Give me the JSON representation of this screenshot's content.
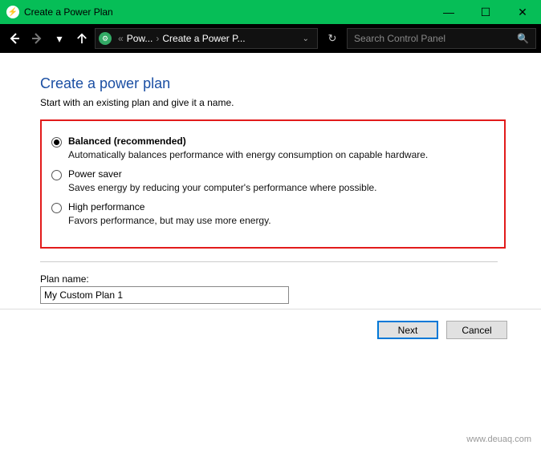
{
  "window": {
    "title": "Create a Power Plan"
  },
  "breadcrumb": {
    "root_prefix": "«",
    "root": "Pow...",
    "current": "Create a Power P..."
  },
  "search": {
    "placeholder": "Search Control Panel"
  },
  "page": {
    "heading": "Create a power plan",
    "subheading": "Start with an existing plan and give it a name."
  },
  "plans": [
    {
      "label": "Balanced (recommended)",
      "description": "Automatically balances performance with energy consumption on capable hardware.",
      "selected": true
    },
    {
      "label": "Power saver",
      "description": "Saves energy by reducing your computer's performance where possible.",
      "selected": false
    },
    {
      "label": "High performance",
      "description": "Favors performance, but may use more energy.",
      "selected": false
    }
  ],
  "plan_name": {
    "label": "Plan name:",
    "value": "My Custom Plan 1"
  },
  "buttons": {
    "next": "Next",
    "cancel": "Cancel"
  },
  "watermark": "www.deuaq.com"
}
